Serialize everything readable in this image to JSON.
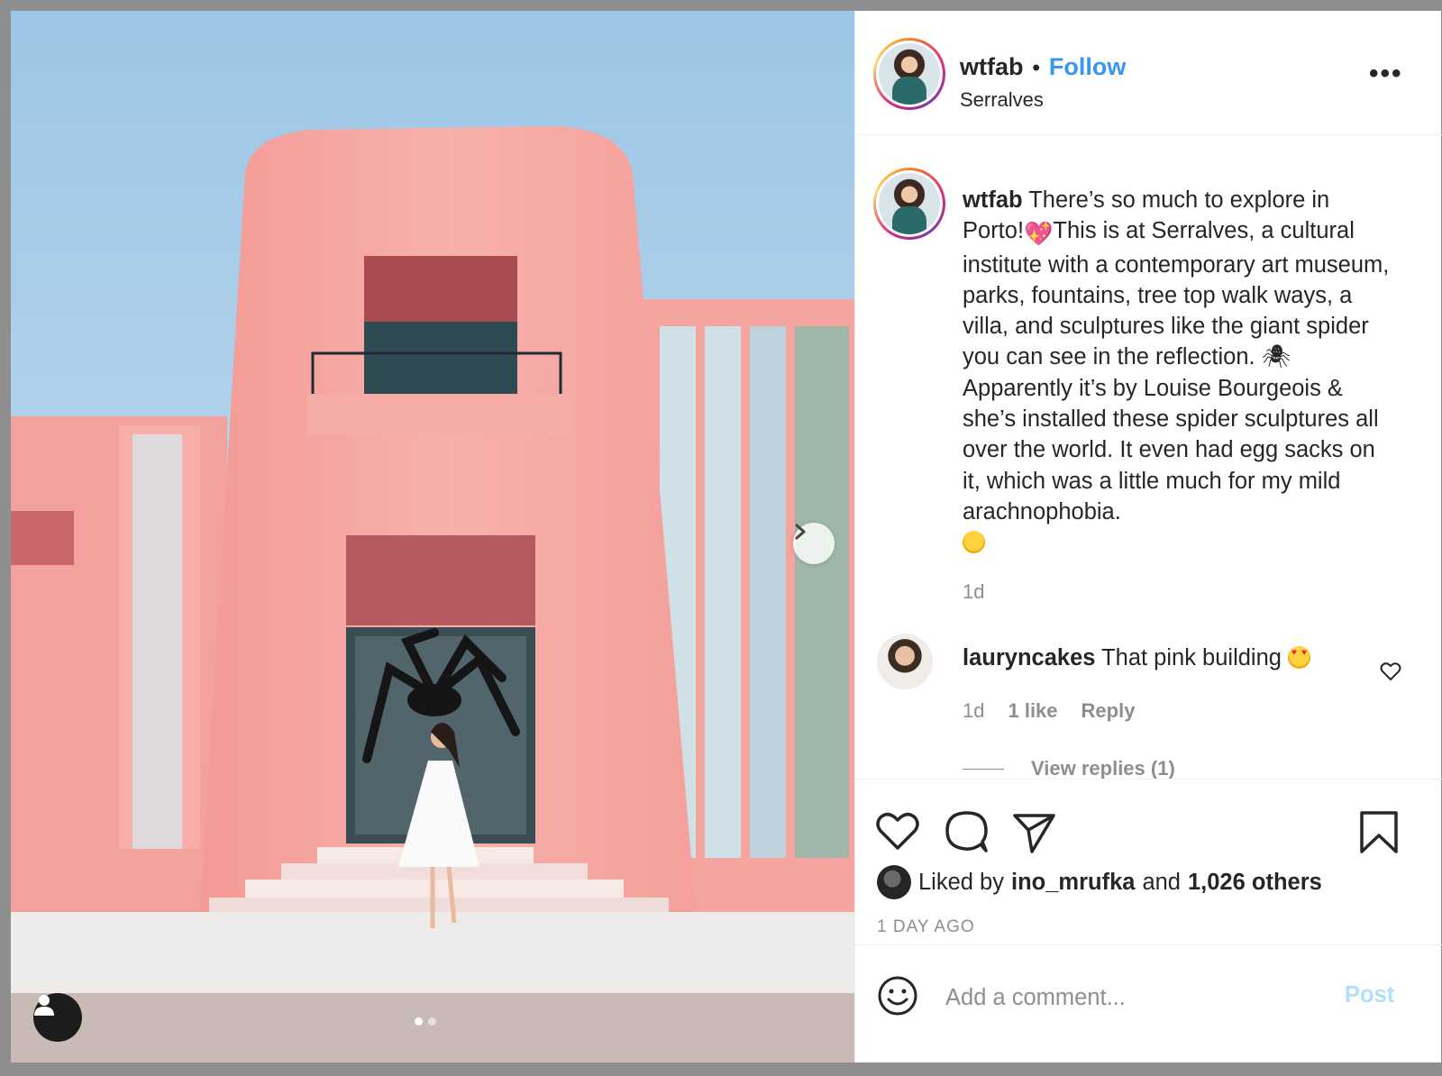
{
  "post": {
    "username": "wtfab",
    "follow_label": "Follow",
    "separator": "•",
    "location": "Serralves",
    "more_label": "•••"
  },
  "caption": {
    "username": "wtfab",
    "text_part1": "There’s so much to explore in Porto!",
    "heart_emoji": "💖",
    "text_part2": "This is at Serralves, a cultural institute with a contemporary art museum, parks, fountains, tree top walk ways, a villa, and sculptures like the giant spider you can see in the reflection.",
    "spider_emoji": "🕷",
    "text_part3": "Apparently it’s by Louise Bourgeois & she’s installed these spider sculptures all over the world. It even had egg sacks on it, which was a little much for my mild arachnophobia.",
    "time": "1d"
  },
  "comment": {
    "username": "lauryncakes",
    "text": "That pink building",
    "time": "1d",
    "likes": "1 like",
    "reply_label": "Reply",
    "view_replies": "View replies (1)"
  },
  "likes": {
    "prefix": "Liked by",
    "user": "ino_mrufka",
    "and": "and",
    "others": "1,026 others"
  },
  "date": "1 DAY AGO",
  "add_comment": {
    "placeholder": "Add a comment...",
    "post_label": "Post"
  },
  "carousel": {
    "slide_count": 2,
    "active_index": 0
  },
  "colors": {
    "accent": "#3897f0",
    "post_disabled": "#b2dffc",
    "muted": "#8e8e8e",
    "building": "#f4a3a0"
  }
}
